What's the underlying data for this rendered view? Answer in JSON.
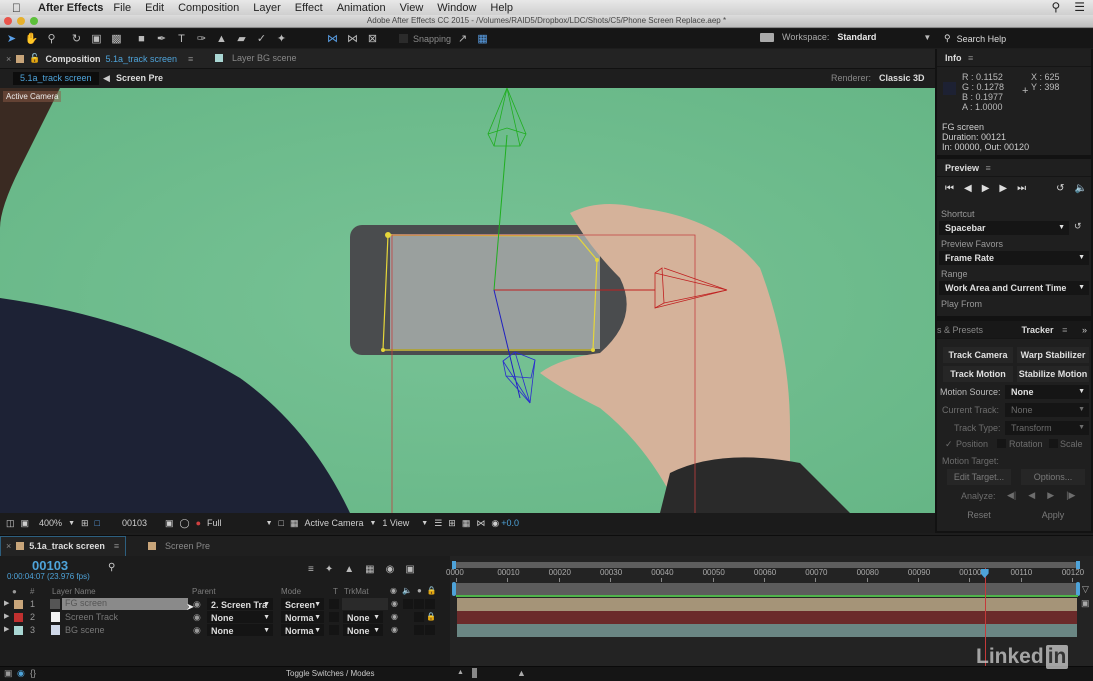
{
  "menubar": {
    "app_name": "After Effects",
    "items": [
      "File",
      "Edit",
      "Composition",
      "Layer",
      "Effect",
      "Animation",
      "View",
      "Window",
      "Help"
    ],
    "icons": [
      "apple-icon",
      "spotlight-search-icon",
      "notification-list-icon"
    ]
  },
  "window": {
    "title": "Adobe After Effects CC 2015 - /Volumes/RAID5/Dropbox/LDC/Shots/C5/Phone Screen Replace.aep *"
  },
  "toolbar": {
    "tools": [
      "selection-tool",
      "hand-tool",
      "zoom-tool",
      "rotation-tool",
      "camera-tool",
      "pan-behind-tool",
      "rectangle-tool",
      "pen-tool",
      "type-tool",
      "brush-tool",
      "clone-stamp-tool",
      "eraser-tool",
      "roto-brush-tool",
      "puppet-pin-tool"
    ],
    "axis_modes": [
      "local-axis-mode",
      "world-axis-mode",
      "view-axis-mode"
    ],
    "snapping_label": "Snapping",
    "workspace_label": "Workspace:",
    "workspace_value": "Standard",
    "search_help": "Search Help"
  },
  "composition": {
    "tab_prefix": "Composition",
    "tab_name": "5.1a_track screen",
    "layer_tab": "Layer BG scene",
    "breadcrumb_active": "5.1a_track screen",
    "breadcrumb_next": "Screen Pre",
    "renderer_label": "Renderer:",
    "renderer_value": "Classic 3D",
    "view_label": "Active Camera",
    "footer": {
      "zoom": "400%",
      "timecode": "00103",
      "resolution": "Full",
      "camera": "Active Camera",
      "views": "1 View",
      "exposure": "+0.0"
    }
  },
  "info": {
    "title": "Info",
    "r": "R : 0.1152",
    "g": "G : 0.1278",
    "b": "B : 0.1977",
    "a": "A :  1.0000",
    "x": "X : 625",
    "y": "Y : 398",
    "swatch_color": "#1d2133",
    "layer": "FG screen",
    "duration": "Duration: 00121",
    "inout": "In: 00000, Out: 00120"
  },
  "preview": {
    "title": "Preview",
    "shortcut_label": "Shortcut",
    "shortcut_value": "Spacebar",
    "favors_label": "Preview Favors",
    "favors_value": "Frame Rate",
    "range_label": "Range",
    "range_value": "Work Area and Current Time",
    "play_from_label": "Play From"
  },
  "tracker": {
    "prev_tab": "s & Presets",
    "title": "Tracker",
    "track_camera": "Track Camera",
    "warp_stabilizer": "Warp Stabilizer",
    "track_motion": "Track Motion",
    "stabilize_motion": "Stabilize Motion",
    "motion_source_label": "Motion Source:",
    "motion_source_value": "None",
    "current_track_label": "Current Track:",
    "current_track_value": "None",
    "track_type_label": "Track Type:",
    "track_type_value": "Transform",
    "position": "Position",
    "rotation": "Rotation",
    "scale": "Scale",
    "motion_target_label": "Motion Target:",
    "edit_target": "Edit Target...",
    "options": "Options...",
    "analyze_label": "Analyze:",
    "reset": "Reset",
    "apply": "Apply"
  },
  "timeline": {
    "tab_active": "5.1a_track screen",
    "tab_other": "Screen Pre",
    "current_frame": "00103",
    "current_time": "0:00:04:07 (23.976 fps)",
    "headers": {
      "num": "#",
      "layer_name": "Layer Name",
      "parent": "Parent",
      "mode": "Mode",
      "t": "T",
      "trkmat": "TrkMat"
    },
    "layers": [
      {
        "num": "1",
        "name": "FG screen",
        "label_color": "#c8a57a",
        "parent": "2. Screen Tra",
        "mode": "Screen",
        "trkmat": "",
        "bar_color": "#a59478"
      },
      {
        "num": "2",
        "name": "Screen Track",
        "label_color": "#c0302f",
        "parent": "None",
        "mode": "Norma",
        "trkmat": "None",
        "bar_color": "#6b2a2a"
      },
      {
        "num": "3",
        "name": "BG scene",
        "label_color": "#a9d6d3",
        "parent": "None",
        "mode": "Norma",
        "trkmat": "None",
        "bar_color": "#6a8683"
      }
    ],
    "ruler_ticks": [
      "0000",
      "00010",
      "00020",
      "00030",
      "00040",
      "00050",
      "00060",
      "00070",
      "00080",
      "00090",
      "00100",
      "00110",
      "00120"
    ],
    "ruler_range": [
      0,
      121
    ],
    "playhead_frame": 103,
    "toggle_label": "Toggle Switches / Modes"
  },
  "watermark": "Linked in"
}
